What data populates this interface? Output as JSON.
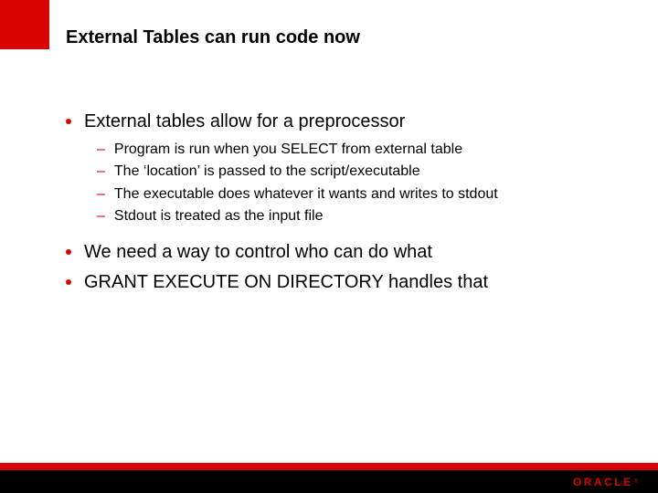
{
  "title": "External Tables can run code now",
  "bullets": [
    {
      "text": "External tables allow for a preprocessor",
      "subs": [
        "Program is run when you SELECT from external table",
        "The ‘location’ is passed to the script/executable",
        "The executable does whatever it wants and writes to stdout",
        "Stdout is treated as the input file"
      ]
    },
    {
      "text": "We need a way to control who can do what",
      "subs": []
    },
    {
      "text": "GRANT EXECUTE ON DIRECTORY handles that",
      "subs": []
    }
  ],
  "logo": {
    "text": "ORACLE",
    "reg": "®"
  }
}
